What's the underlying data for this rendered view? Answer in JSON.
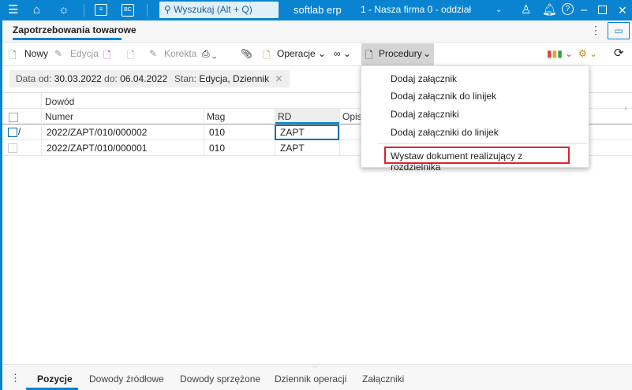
{
  "topbar": {
    "search_placeholder": "Wyszukaj (Alt + Q)",
    "app_name": "softlab erp",
    "company": "1 - Nasza firma 0 - oddział",
    "bc_label": "BC"
  },
  "title": {
    "tab": "Zapotrzebowania towarowe"
  },
  "toolbar": {
    "new": "Nowy",
    "edit": "Edycja",
    "correct": "Korekta",
    "operations": "Operacje",
    "procedures": "Procedury"
  },
  "filters": {
    "date_label": "Data",
    "from_label": "od:",
    "from": "30.03.2022",
    "to_label": "do:",
    "to": "06.04.2022",
    "state_label": "Stan:",
    "state": "Edycja, Dziennik"
  },
  "grid": {
    "group": "Dowód",
    "columns": [
      "Numer",
      "Mag",
      "RD",
      "Opis"
    ],
    "rows": [
      {
        "numer": "2022/ZAPT/010/000002",
        "mag": "010",
        "rd": "ZAPT"
      },
      {
        "numer": "2022/ZAPT/010/000001",
        "mag": "010",
        "rd": "ZAPT"
      }
    ]
  },
  "menu": {
    "items": [
      "Dodaj załącznik",
      "Dodaj załącznik do linijek",
      "Dodaj załączniki",
      "Dodaj załączniki do linijek",
      "Wystaw dokument realizujący z rozdzielnika"
    ]
  },
  "bottom_tabs": [
    "Pozycje",
    "Dowody źródłowe",
    "Dowody sprzężone",
    "Dziennik operacji",
    "Załączniki"
  ],
  "colors": {
    "brand": "#0a84d0",
    "highlight": "#e0202a"
  }
}
